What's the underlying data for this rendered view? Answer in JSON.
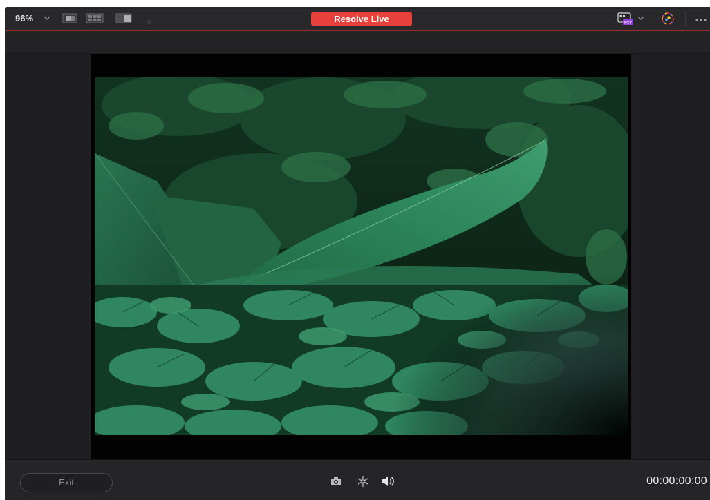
{
  "toolbar": {
    "zoom_value": "96%",
    "zoom_chevron_icon": "chevron-down-icon",
    "view_icons": [
      "single-viewer-icon",
      "grid-viewer-icon",
      "split-wipe-icon",
      "dot-icon"
    ],
    "live_button_label": "Resolve Live",
    "live_button_color": "#e8403a",
    "right_icons": [
      "proxy-icon",
      "chevron-down-icon",
      "color-wheel-icon",
      "more-options-icon"
    ]
  },
  "bottom": {
    "exit_label": "Exit",
    "icons": [
      "camera-snapshot-icon",
      "freeze-icon",
      "speaker-icon"
    ],
    "timecode": "00:00:00:00"
  },
  "colors": {
    "background": "#1f1f21",
    "toolbar": "#28282a",
    "accent": "#a1282c"
  }
}
